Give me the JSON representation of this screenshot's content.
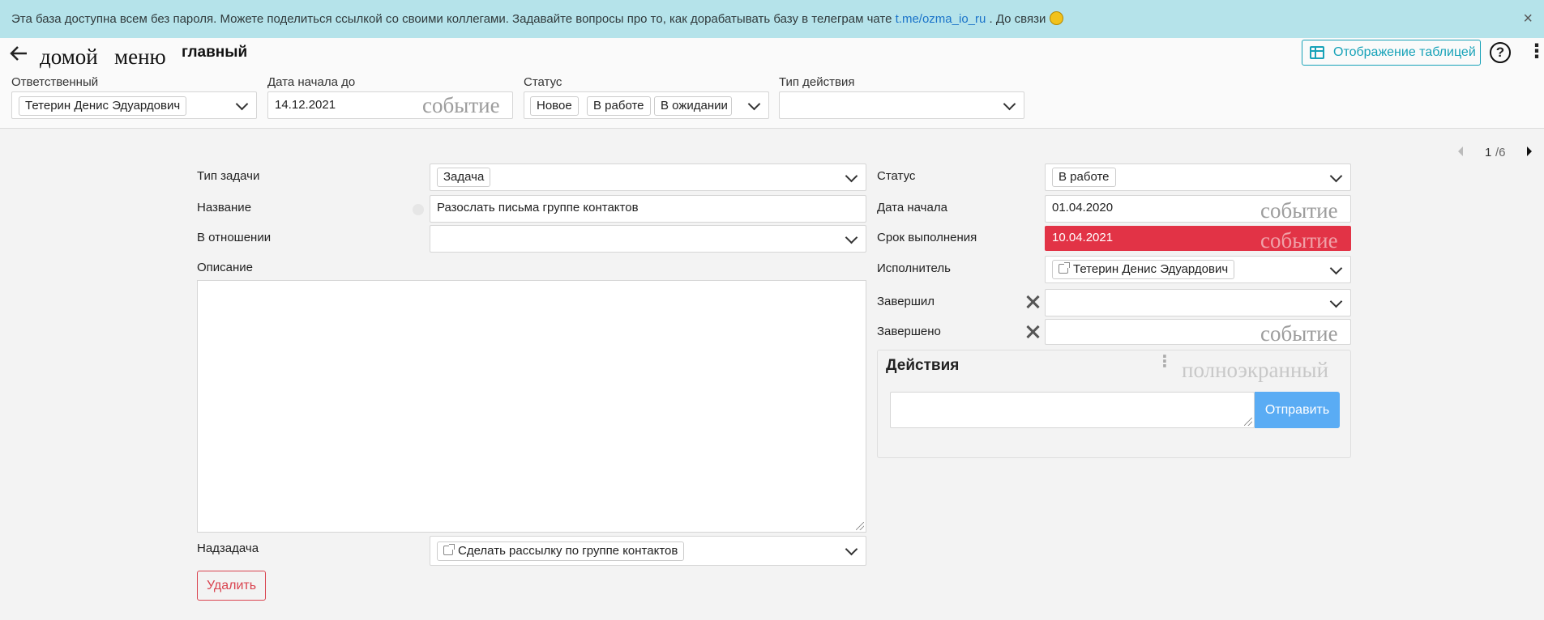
{
  "banner": {
    "text": "Эта база доступна всем без пароля. Можете поделиться ссылкой со своими коллегами. Задавайте вопросы про то, как дорабатывать базу в телеграм чате ",
    "link": "t.me/ozma_io_ru",
    "tail": " . До связи ",
    "close": "×"
  },
  "header": {
    "back_icon": "arrow-left-icon",
    "crumb_home": "домой",
    "crumb_menu": "меню",
    "title": "главный",
    "table_view": "Отображение таблицей",
    "help": "?",
    "more": "⋮"
  },
  "filters": {
    "responsible": {
      "label": "Ответственный",
      "value": "Тетерин Денис Эдуардович"
    },
    "start_date": {
      "label": "Дата начала до",
      "value": "14.12.2021",
      "ghost": "событие"
    },
    "status": {
      "label": "Статус",
      "tags": [
        "Новое",
        "В работе",
        "В ожидании"
      ]
    },
    "action_type": {
      "label": "Тип действия",
      "value": ""
    }
  },
  "pager": {
    "current": "1",
    "total": "/6"
  },
  "form": {
    "task_type": {
      "label": "Тип задачи",
      "value": "Задача"
    },
    "name": {
      "label": "Название",
      "value": "Разослать письма группе контактов"
    },
    "relation": {
      "label": "В отношении",
      "value": ""
    },
    "description": {
      "label": "Описание",
      "value": ""
    },
    "parent": {
      "label": "Надзадача",
      "value": "Сделать рассылку по группе контактов"
    },
    "delete": "Удалить",
    "status": {
      "label": "Статус",
      "value": "В работе"
    },
    "start": {
      "label": "Дата начала",
      "value": "01.04.2020",
      "ghost": "событие"
    },
    "deadline": {
      "label": "Срок выполнения",
      "value": "10.04.2021",
      "ghost": "событие"
    },
    "executor": {
      "label": "Исполнитель",
      "value": "Тетерин Денис Эдуардович"
    },
    "finished_by": {
      "label": "Завершил",
      "value": ""
    },
    "finished": {
      "label": "Завершено",
      "value": "",
      "ghost": "событие"
    }
  },
  "actions": {
    "title": "Действия",
    "ghost": "полноэкранный",
    "send": "Отправить"
  },
  "colors": {
    "banner": "#b5e3ea",
    "accent": "#17a2b8",
    "danger": "#e23346",
    "send": "#5aacf4"
  }
}
